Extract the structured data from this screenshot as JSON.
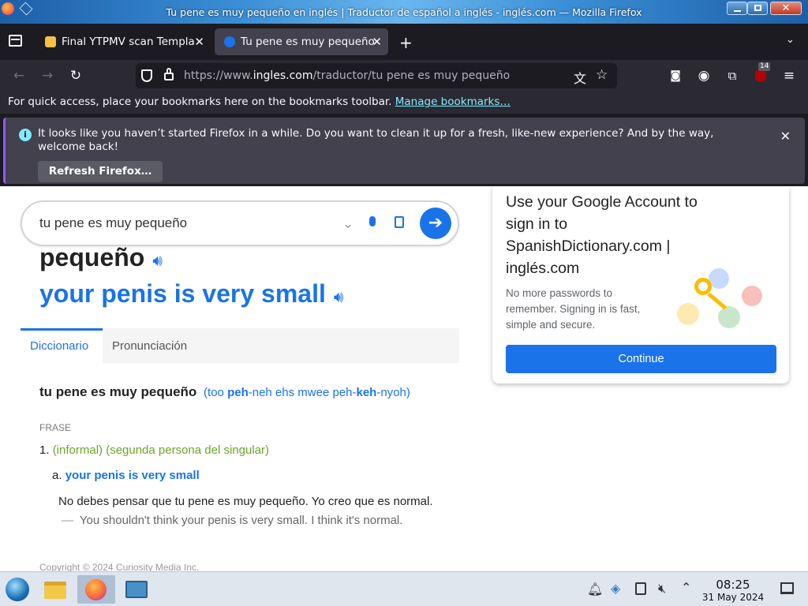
{
  "window": {
    "title": "Tu pene es muy pequeño en inglés | Traductor de español a inglés - inglés.com — Mozilla Firefox"
  },
  "tabs": [
    {
      "label": "Final YTPMV scan Templa",
      "active": false
    },
    {
      "label": "Tu pene es muy pequeño",
      "active": true
    }
  ],
  "urlbar": {
    "prefix": "https://www.",
    "domain": "ingles.com",
    "path": "/traductor/tu pene es muy pequeño"
  },
  "extensions_badge": "14",
  "bookmarks_bar": {
    "text": "For quick access, place your bookmarks here on the bookmarks toolbar.",
    "link": "Manage bookmarks…"
  },
  "notification": {
    "message": "It looks like you haven’t started Firefox in a while. Do you want to clean it up for a fresh, like-new experience? And by the way, welcome back!",
    "button": "Refresh Firefox…"
  },
  "search": {
    "query": "tu pene es muy pequeño"
  },
  "heading": {
    "source_tail": "pequeño",
    "translation": "your penis is very small"
  },
  "content_tabs": [
    "Diccionario",
    "Pronunciación"
  ],
  "entry": {
    "phrase": "tu pene es muy pequeño",
    "pronunciation_parts": [
      "(too ",
      "peh",
      "-neh ehs mwee peh-",
      "keh",
      "-nyoh)"
    ],
    "part_of_speech": "FRASE",
    "sense_number": "1.",
    "sense_label": "(informal) (segunda persona del singular)",
    "sub_letter": "a.",
    "translation": "your penis is very small",
    "example_es": "No debes pensar que tu pene es muy pequeño. Yo creo que es normal.",
    "example_dash": "—",
    "example_en": "You shouldn't think your penis is very small. I think it's normal.",
    "copyright": "Copyright © 2024 Curiosity Media Inc."
  },
  "google_card": {
    "title": "Use your Google Account to sign in to SpanishDictionary.com | inglés.com",
    "description": "No more passwords to remember. Signing in is fast, simple and secure.",
    "button": "Continue"
  },
  "taskbar": {
    "time": "08:25",
    "date": "31 May 2024"
  },
  "colors": {
    "accent": "#1a73e8",
    "firefox_dark": "#1c1b22",
    "green": "#6aa52a"
  }
}
